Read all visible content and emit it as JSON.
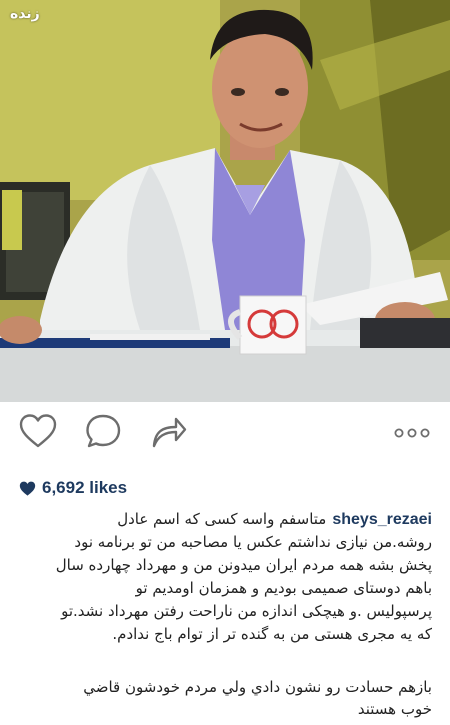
{
  "photo": {
    "live_tag": "زنده",
    "description_icon": "tv-presenter-photo"
  },
  "actions": {
    "like_icon": "heart-outline-icon",
    "comment_icon": "comment-bubble-icon",
    "share_icon": "share-arrow-icon",
    "more_icon": "more-dots-icon"
  },
  "likes": {
    "icon": "heart-filled-icon",
    "text": "6,692 likes"
  },
  "caption": {
    "username": "sheys_rezaei",
    "lines": [
      "متاسفم واسه کسی که اسم عادل",
      "روشه.من نیازی نداشتم عکس یا مصاحبه من تو برنامه نود",
      "پخش بشه همه مردم ایران میدونن من و مهرداد چهارده سال",
      "باهم دوستای صمیمی بودیم و همزمان اومدیم تو",
      "پرسپولیس .و هیچکی اندازه من ناراحت رفتن مهرداد نشد.تو",
      "که یه مجری هستی من به گنده تر از توام باج ندادم."
    ]
  },
  "comment": {
    "lines": [
      "بازهم حسادت رو نشون دادي ولي مردم خودشون قاضي",
      "خوب هستند"
    ]
  },
  "colors": {
    "username": "#1e3a5f",
    "text": "#222222",
    "heart": "#1e3a5f"
  }
}
